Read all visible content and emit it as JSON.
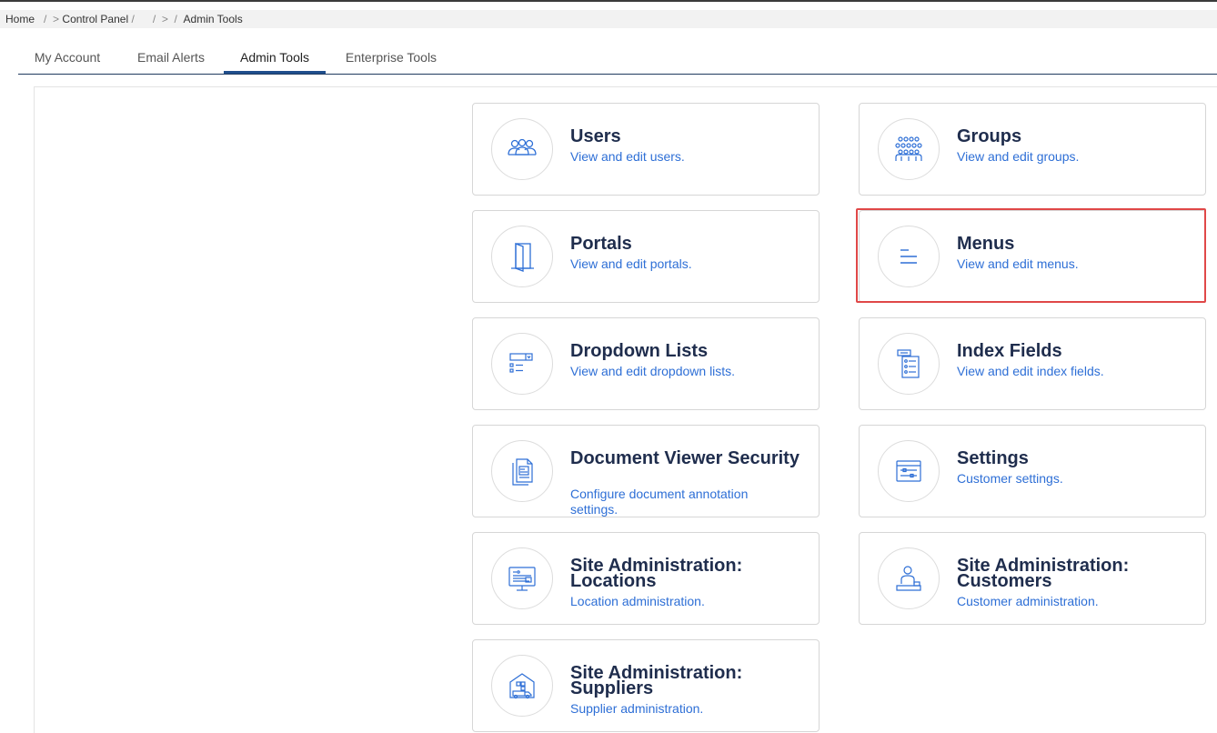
{
  "breadcrumb": {
    "home": "Home",
    "sep1": "/",
    "arrow1": ">",
    "control_panel": "Control Panel",
    "sep2": "/",
    "sep3": "/",
    "arrow2": ">",
    "sep4": "/",
    "admin_tools": "Admin Tools"
  },
  "tabs": [
    {
      "label": "My Account"
    },
    {
      "label": "Email Alerts"
    },
    {
      "label": "Admin Tools"
    },
    {
      "label": "Enterprise Tools"
    }
  ],
  "active_tab": "Admin Tools",
  "cards": [
    {
      "title": "Users",
      "desc": "View and edit users.",
      "icon": "users-icon"
    },
    {
      "title": "Groups",
      "desc": "View and edit groups.",
      "icon": "groups-icon"
    },
    {
      "title": "Portals",
      "desc": "View and edit portals.",
      "icon": "door-icon"
    },
    {
      "title": "Menus",
      "desc": "View and edit menus.",
      "icon": "menu-lines-icon"
    },
    {
      "title": "Dropdown Lists",
      "desc": "View and edit dropdown lists.",
      "icon": "dropdown-list-icon"
    },
    {
      "title": "Index Fields",
      "desc": "View and edit index fields.",
      "icon": "index-fields-icon"
    },
    {
      "title": "Document Viewer Security",
      "desc": "Configure document annotation settings.",
      "icon": "document-icon"
    },
    {
      "title": "Settings",
      "desc": "Customer settings.",
      "icon": "settings-window-icon"
    },
    {
      "title": "Site Administration: Locations",
      "desc": "Location administration.",
      "icon": "monitor-icon"
    },
    {
      "title": "Site Administration: Customers",
      "desc": "Customer administration.",
      "icon": "customer-icon"
    },
    {
      "title": "Site Administration: Suppliers",
      "desc": "Supplier administration.",
      "icon": "warehouse-truck-icon"
    }
  ],
  "colors": {
    "title": "#1f2d4d",
    "link": "#2e6fd6",
    "icon": "#2e6fd6",
    "highlight": "#e04848",
    "tab_underline": "#1f4e8c"
  }
}
